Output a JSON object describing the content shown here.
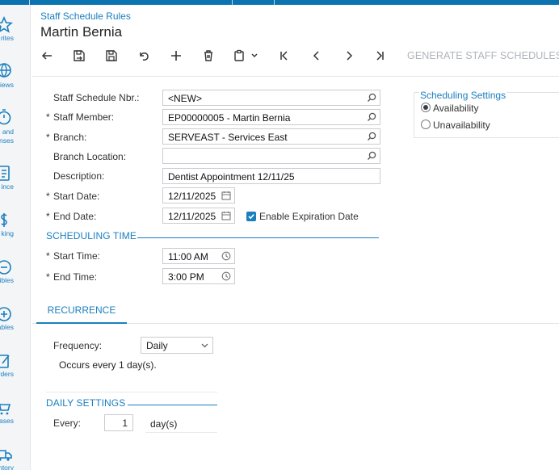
{
  "nav": [
    {
      "label": "rites",
      "icon": "star-icon"
    },
    {
      "label": "Views",
      "icon": "globe-icon"
    },
    {
      "label": "and\nnses",
      "icon": "timer-icon"
    },
    {
      "label": "ince",
      "icon": "document-icon"
    },
    {
      "label": "king",
      "icon": "money-icon"
    },
    {
      "label": "ibles",
      "icon": "minus-circle-icon"
    },
    {
      "label": "ables",
      "icon": "plus-circle-icon"
    },
    {
      "label": "Orders",
      "icon": "edit-icon"
    },
    {
      "label": "ases",
      "icon": "cart-icon"
    },
    {
      "label": "ntory",
      "icon": "truck-icon"
    }
  ],
  "header": {
    "screen_title": "Staff Schedule Rules",
    "page_title": "Martin Bernia"
  },
  "toolbar": {
    "buttons": [
      "back-icon",
      "save-close-icon",
      "save-icon",
      "undo-icon",
      "add-icon",
      "delete-icon",
      "copy-paste-icon",
      "first-icon",
      "previous-icon",
      "next-icon",
      "last-icon"
    ],
    "action_label": "GENERATE STAFF SCHEDULES"
  },
  "form": {
    "schedule_nbr": {
      "label": "Staff Schedule Nbr.:",
      "value": "<NEW>"
    },
    "staff_member": {
      "label": "Staff Member:",
      "value": "EP00000005 - Martin Bernia"
    },
    "branch": {
      "label": "Branch:",
      "value": "SERVEAST - Services East"
    },
    "branch_location": {
      "label": "Branch Location:",
      "value": ""
    },
    "description": {
      "label": "Description:",
      "value": "Dentist Appointment 12/11/25"
    },
    "start_date": {
      "label": "Start Date:",
      "value": "12/11/2025"
    },
    "end_date": {
      "label": "End Date:",
      "value": "12/11/2025"
    },
    "enable_expiration": {
      "label": "Enable Expiration Date",
      "checked": true
    },
    "required_mark": "*"
  },
  "scheduling_time": {
    "title": "SCHEDULING TIME",
    "start_time": {
      "label": "Start Time:",
      "value": "11:00 AM"
    },
    "end_time": {
      "label": "End Time:",
      "value": "3:00 PM"
    }
  },
  "scheduling_settings": {
    "title": "Scheduling Settings",
    "options": [
      {
        "label": "Availability",
        "selected": true
      },
      {
        "label": "Unavailability",
        "selected": false
      }
    ]
  },
  "tabs": [
    {
      "label": "RECURRENCE",
      "active": true
    }
  ],
  "recurrence": {
    "frequency_label": "Frequency:",
    "frequency_value": "Daily",
    "occurs_text": "Occurs every 1 day(s).",
    "daily_settings_title": "DAILY SETTINGS",
    "every_label": "Every:",
    "every_value": "1",
    "every_unit": "day(s)"
  },
  "colors": {
    "accent": "#1a7fbf",
    "topbar": "#0b74b0",
    "disabled_text": "#b0b4b9"
  }
}
